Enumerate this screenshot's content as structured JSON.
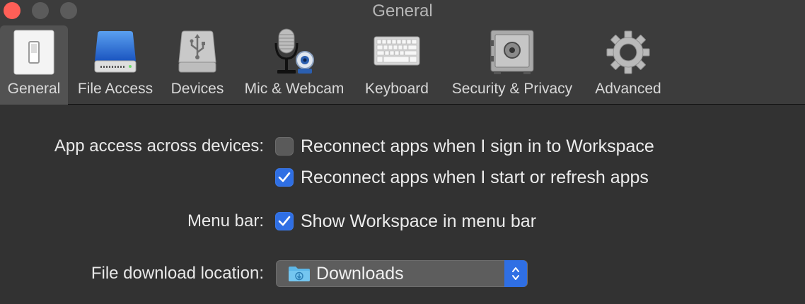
{
  "window": {
    "title": "General"
  },
  "toolbar": {
    "items": [
      {
        "label": "General",
        "icon": "light-switch-icon",
        "selected": true
      },
      {
        "label": "File Access",
        "icon": "hard-drive-icon"
      },
      {
        "label": "Devices",
        "icon": "usb-drive-icon"
      },
      {
        "label": "Mic & Webcam",
        "icon": "microphone-webcam-icon"
      },
      {
        "label": "Keyboard",
        "icon": "keyboard-icon"
      },
      {
        "label": "Security & Privacy",
        "icon": "safe-icon"
      },
      {
        "label": "Advanced",
        "icon": "gear-icon"
      }
    ]
  },
  "settings": {
    "app_access": {
      "label": "App access across devices:",
      "option1": {
        "text": "Reconnect apps when I sign in to Workspace",
        "checked": false
      },
      "option2": {
        "text": "Reconnect apps when I start or refresh apps",
        "checked": true
      }
    },
    "menu_bar": {
      "label": "Menu bar:",
      "option": {
        "text": "Show Workspace in menu bar",
        "checked": true
      }
    },
    "download": {
      "label": "File download location:",
      "value": "Downloads",
      "icon": "downloads-folder-icon"
    }
  },
  "colors": {
    "accent": "#2f6fe4",
    "close": "#ff5f57",
    "background": "#323232"
  }
}
